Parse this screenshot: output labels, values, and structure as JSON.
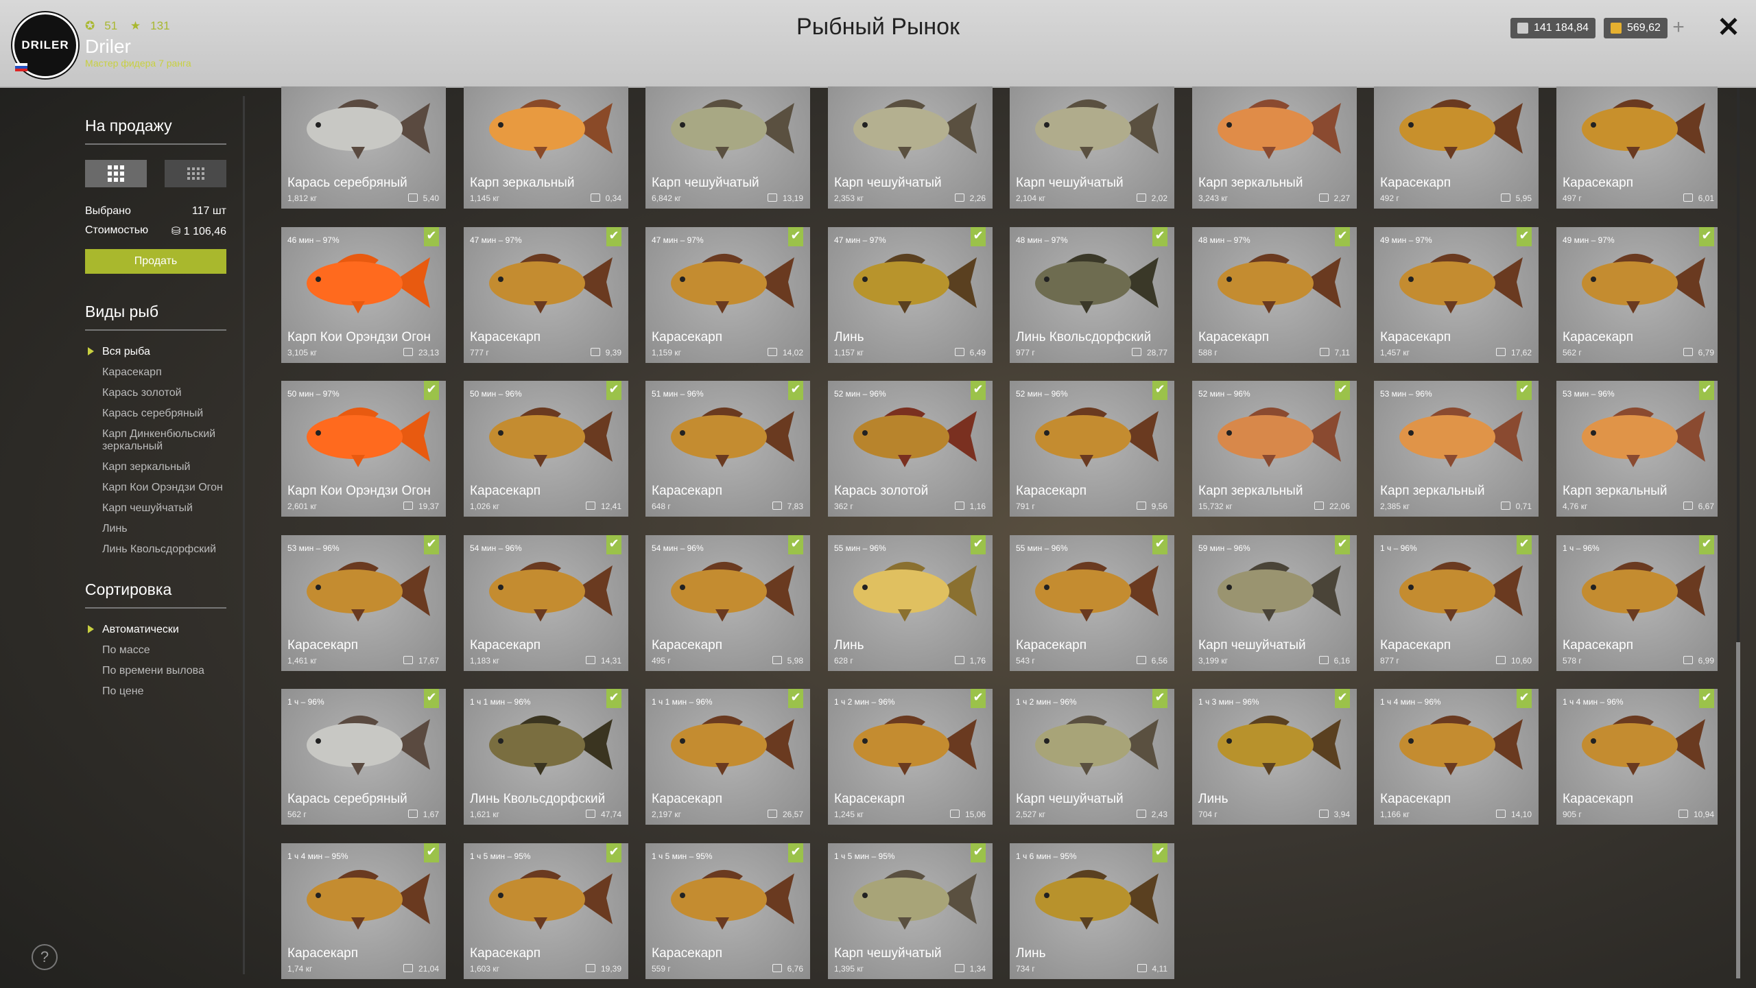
{
  "header": {
    "title": "Рыбный Рынок",
    "player_name": "Driler",
    "player_rank": "Мастер фидера 7 ранга",
    "stat_level": "51",
    "stat_stars": "131",
    "logo_text": "DRILER",
    "silver": "141 184,84",
    "gold": "569,62",
    "plus": "+",
    "close": "✕"
  },
  "sidebar": {
    "for_sale_title": "На продажу",
    "selected_label": "Выбрано",
    "selected_value": "117 шт",
    "cost_label": "Стоимостью",
    "cost_value": "1 106,46",
    "sell_button": "Продать",
    "species_title": "Виды рыб",
    "species": [
      "Вся рыба",
      "Карасекарп",
      "Карась золотой",
      "Карась серебряный",
      "Карп Динкенбюльский зеркальный",
      "Карп зеркальный",
      "Карп Кои Орэндзи Огон",
      "Карп чешуйчатый",
      "Линь",
      "Линь Квольсдорфский"
    ],
    "sort_title": "Сортировка",
    "sort_options": [
      "Автоматически",
      "По массе",
      "По времени вылова",
      "По цене"
    ],
    "help": "?"
  },
  "fish": [
    {
      "name": "Карась серебряный",
      "weight": "1,812 кг",
      "price": "5,40",
      "time": "",
      "checked": false,
      "body": "#c8c8c4",
      "fin": "#5a4a40"
    },
    {
      "name": "Карп зеркальный",
      "weight": "1,145 кг",
      "price": "0,34",
      "time": "",
      "checked": false,
      "body": "#e89a40",
      "fin": "#8a4a28"
    },
    {
      "name": "Карп чешуйчатый",
      "weight": "6,842 кг",
      "price": "13,19",
      "time": "",
      "checked": false,
      "body": "#a8a884",
      "fin": "#5a5040"
    },
    {
      "name": "Карп чешуйчатый",
      "weight": "2,353 кг",
      "price": "2,26",
      "time": "",
      "checked": false,
      "body": "#b4b090",
      "fin": "#5a5040"
    },
    {
      "name": "Карп чешуйчатый",
      "weight": "2,104 кг",
      "price": "2,02",
      "time": "",
      "checked": false,
      "body": "#b0ac8c",
      "fin": "#5a5040"
    },
    {
      "name": "Карп зеркальный",
      "weight": "3,243 кг",
      "price": "2,27",
      "time": "",
      "checked": false,
      "body": "#e08c48",
      "fin": "#8a4a30"
    },
    {
      "name": "Карасекарп",
      "weight": "492 г",
      "price": "5,95",
      "time": "",
      "checked": false,
      "body": "#c8902c",
      "fin": "#6a3a20"
    },
    {
      "name": "Карасекарп",
      "weight": "497 г",
      "price": "6,01",
      "time": "",
      "checked": false,
      "body": "#c8902c",
      "fin": "#6a3a20"
    },
    {
      "name": "Карп Кои Орэндзи Огон",
      "weight": "3,105 кг",
      "price": "23,13",
      "time": "46 мин – 97%",
      "checked": true,
      "body": "#ff6a1e",
      "fin": "#e85a10"
    },
    {
      "name": "Карасекарп",
      "weight": "777 г",
      "price": "9,39",
      "time": "47 мин – 97%",
      "checked": true,
      "body": "#c48c30",
      "fin": "#6a3a20"
    },
    {
      "name": "Карасекарп",
      "weight": "1,159 кг",
      "price": "14,02",
      "time": "47 мин – 97%",
      "checked": true,
      "body": "#c48c30",
      "fin": "#6a3a20"
    },
    {
      "name": "Линь",
      "weight": "1,157 кг",
      "price": "6,49",
      "time": "47 мин – 97%",
      "checked": true,
      "body": "#b8942c",
      "fin": "#5a4020"
    },
    {
      "name": "Линь Квольсдорфский",
      "weight": "977 г",
      "price": "28,77",
      "time": "48 мин – 97%",
      "checked": true,
      "body": "#6e6c50",
      "fin": "#3a3828"
    },
    {
      "name": "Карасекарп",
      "weight": "588 г",
      "price": "7,11",
      "time": "48 мин – 97%",
      "checked": true,
      "body": "#c48c30",
      "fin": "#6a3a20"
    },
    {
      "name": "Карасекарп",
      "weight": "1,457 кг",
      "price": "17,62",
      "time": "49 мин – 97%",
      "checked": true,
      "body": "#c48c30",
      "fin": "#6a3a20"
    },
    {
      "name": "Карасекарп",
      "weight": "562 г",
      "price": "6,79",
      "time": "49 мин – 97%",
      "checked": true,
      "body": "#c48c30",
      "fin": "#6a3a20"
    },
    {
      "name": "Карп Кои Орэндзи Огон",
      "weight": "2,601 кг",
      "price": "19,37",
      "time": "50 мин – 97%",
      "checked": true,
      "body": "#ff6a1e",
      "fin": "#e85a10"
    },
    {
      "name": "Карасекарп",
      "weight": "1,026 кг",
      "price": "12,41",
      "time": "50 мин – 96%",
      "checked": true,
      "body": "#c48c30",
      "fin": "#6a3a20"
    },
    {
      "name": "Карасекарп",
      "weight": "648 г",
      "price": "7,83",
      "time": "51 мин – 96%",
      "checked": true,
      "body": "#c48c30",
      "fin": "#6a3a20"
    },
    {
      "name": "Карась золотой",
      "weight": "362 г",
      "price": "1,16",
      "time": "52 мин – 96%",
      "checked": true,
      "body": "#b8842c",
      "fin": "#7a3020"
    },
    {
      "name": "Карасекарп",
      "weight": "791 г",
      "price": "9,56",
      "time": "52 мин – 96%",
      "checked": true,
      "body": "#c48c30",
      "fin": "#6a3a20"
    },
    {
      "name": "Карп зеркальный",
      "weight": "15,732 кг",
      "price": "22,06",
      "time": "52 мин – 96%",
      "checked": true,
      "body": "#d8884a",
      "fin": "#8a4a30"
    },
    {
      "name": "Карп зеркальный",
      "weight": "2,385 кг",
      "price": "0,71",
      "time": "53 мин – 96%",
      "checked": true,
      "body": "#e09448",
      "fin": "#8a4a30"
    },
    {
      "name": "Карп зеркальный",
      "weight": "4,76 кг",
      "price": "6,67",
      "time": "53 мин – 96%",
      "checked": true,
      "body": "#e09448",
      "fin": "#8a4a30"
    },
    {
      "name": "Карасекарп",
      "weight": "1,461 кг",
      "price": "17,67",
      "time": "53 мин – 96%",
      "checked": true,
      "body": "#c48c30",
      "fin": "#6a3a20"
    },
    {
      "name": "Карасекарп",
      "weight": "1,183 кг",
      "price": "14,31",
      "time": "54 мин – 96%",
      "checked": true,
      "body": "#c48c30",
      "fin": "#6a3a20"
    },
    {
      "name": "Карасекарп",
      "weight": "495 г",
      "price": "5,98",
      "time": "54 мин – 96%",
      "checked": true,
      "body": "#c48c30",
      "fin": "#6a3a20"
    },
    {
      "name": "Линь",
      "weight": "628 г",
      "price": "1,76",
      "time": "55 мин – 96%",
      "checked": true,
      "body": "#e0c060",
      "fin": "#8a7030"
    },
    {
      "name": "Карасекарп",
      "weight": "543 г",
      "price": "6,56",
      "time": "55 мин – 96%",
      "checked": true,
      "body": "#c48c30",
      "fin": "#6a3a20"
    },
    {
      "name": "Карп чешуйчатый",
      "weight": "3,199 кг",
      "price": "6,16",
      "time": "59 мин – 96%",
      "checked": true,
      "body": "#9a9470",
      "fin": "#4a4438"
    },
    {
      "name": "Карасекарп",
      "weight": "877 г",
      "price": "10,60",
      "time": "1 ч – 96%",
      "checked": true,
      "body": "#c48c30",
      "fin": "#6a3a20"
    },
    {
      "name": "Карасекарп",
      "weight": "578 г",
      "price": "6,99",
      "time": "1 ч – 96%",
      "checked": true,
      "body": "#c48c30",
      "fin": "#6a3a20"
    },
    {
      "name": "Карась серебряный",
      "weight": "562 г",
      "price": "1,67",
      "time": "1 ч – 96%",
      "checked": true,
      "body": "#c8c8c4",
      "fin": "#5a4a40"
    },
    {
      "name": "Линь Квольсдорфский",
      "weight": "1,621 кг",
      "price": "47,74",
      "time": "1 ч 1 мин – 96%",
      "checked": true,
      "body": "#7a6e40",
      "fin": "#3a3420"
    },
    {
      "name": "Карасекарп",
      "weight": "2,197 кг",
      "price": "26,57",
      "time": "1 ч 1 мин – 96%",
      "checked": true,
      "body": "#c48c30",
      "fin": "#6a3a20"
    },
    {
      "name": "Карасекарп",
      "weight": "1,245 кг",
      "price": "15,06",
      "time": "1 ч 2 мин – 96%",
      "checked": true,
      "body": "#c48c30",
      "fin": "#6a3a20"
    },
    {
      "name": "Карп чешуйчатый",
      "weight": "2,527 кг",
      "price": "2,43",
      "time": "1 ч 2 мин – 96%",
      "checked": true,
      "body": "#a8a478",
      "fin": "#5a5040"
    },
    {
      "name": "Линь",
      "weight": "704 г",
      "price": "3,94",
      "time": "1 ч 3 мин – 96%",
      "checked": true,
      "body": "#b8922c",
      "fin": "#5a4020"
    },
    {
      "name": "Карасекарп",
      "weight": "1,166 кг",
      "price": "14,10",
      "time": "1 ч 4 мин – 96%",
      "checked": true,
      "body": "#c48c30",
      "fin": "#6a3a20"
    },
    {
      "name": "Карасекарп",
      "weight": "905 г",
      "price": "10,94",
      "time": "1 ч 4 мин – 96%",
      "checked": true,
      "body": "#c48c30",
      "fin": "#6a3a20"
    },
    {
      "name": "Карасекарп",
      "weight": "1,74 кг",
      "price": "21,04",
      "time": "1 ч 4 мин – 95%",
      "checked": true,
      "body": "#c48c30",
      "fin": "#6a3a20"
    },
    {
      "name": "Карасекарп",
      "weight": "1,603 кг",
      "price": "19,39",
      "time": "1 ч 5 мин – 95%",
      "checked": true,
      "body": "#c48c30",
      "fin": "#6a3a20"
    },
    {
      "name": "Карасекарп",
      "weight": "559 г",
      "price": "6,76",
      "time": "1 ч 5 мин – 95%",
      "checked": true,
      "body": "#c48c30",
      "fin": "#6a3a20"
    },
    {
      "name": "Карп чешуйчатый",
      "weight": "1,395 кг",
      "price": "1,34",
      "time": "1 ч 5 мин – 95%",
      "checked": true,
      "body": "#a8a478",
      "fin": "#5a5040"
    },
    {
      "name": "Линь",
      "weight": "734 г",
      "price": "4,11",
      "time": "1 ч 6 мин – 95%",
      "checked": true,
      "body": "#b8922c",
      "fin": "#5a4020"
    }
  ]
}
